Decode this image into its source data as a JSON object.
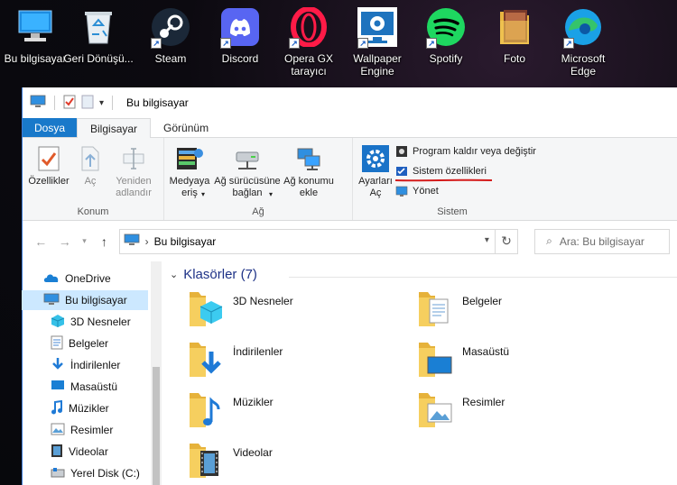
{
  "desktop": {
    "icons": [
      {
        "label": "Bu bilgisayar",
        "icon": "computer-icon"
      },
      {
        "label": "Geri Dönüşü...",
        "icon": "recycle-bin-icon"
      },
      {
        "label": "Steam",
        "icon": "steam-icon"
      },
      {
        "label": "Discord",
        "icon": "discord-icon"
      },
      {
        "label": "Opera GX tarayıcı",
        "icon": "opera-gx-icon"
      },
      {
        "label": "Wallpaper Engine",
        "icon": "wallpaper-engine-icon"
      },
      {
        "label": "Spotify",
        "icon": "spotify-icon"
      },
      {
        "label": "Foto",
        "icon": "photo-icon"
      },
      {
        "label": "Microsoft Edge",
        "icon": "edge-icon"
      }
    ]
  },
  "window": {
    "title": "Bu bilgisayar",
    "tabs": {
      "file": "Dosya",
      "computer": "Bilgisayar",
      "view": "Görünüm"
    },
    "ribbon": {
      "konum": {
        "label": "Konum",
        "properties": "Özellikler",
        "open": "Aç",
        "rename": "Yeniden adlandır"
      },
      "ag": {
        "label": "Ağ",
        "media_access": "Medyaya eriş",
        "map_drive": "Ağ sürücüsüne bağlan",
        "add_location": "Ağ konumu ekle"
      },
      "sistem": {
        "label": "Sistem",
        "settings": "Ayarları Aç",
        "uninstall": "Program kaldır veya değiştir",
        "system_properties": "Sistem özellikleri",
        "manage": "Yönet"
      }
    },
    "address": {
      "path": "Bu bilgisayar",
      "search_placeholder": "Ara: Bu bilgisayar"
    },
    "nav": [
      {
        "label": "OneDrive",
        "icon": "onedrive-icon"
      },
      {
        "label": "Bu bilgisayar",
        "icon": "computer-icon"
      },
      {
        "label": "3D Nesneler",
        "icon": "3d-objects-icon"
      },
      {
        "label": "Belgeler",
        "icon": "documents-icon"
      },
      {
        "label": "İndirilenler",
        "icon": "downloads-icon"
      },
      {
        "label": "Masaüstü",
        "icon": "desktop-icon"
      },
      {
        "label": "Müzikler",
        "icon": "music-icon"
      },
      {
        "label": "Resimler",
        "icon": "pictures-icon"
      },
      {
        "label": "Videolar",
        "icon": "videos-icon"
      },
      {
        "label": "Yerel Disk (C:)",
        "icon": "local-disk-icon"
      }
    ],
    "folders_header": "Klasörler (7)",
    "folders": [
      {
        "label": "3D Nesneler",
        "icon": "3d-objects-icon"
      },
      {
        "label": "Belgeler",
        "icon": "documents-icon"
      },
      {
        "label": "İndirilenler",
        "icon": "downloads-icon"
      },
      {
        "label": "Masaüstü",
        "icon": "desktop-icon"
      },
      {
        "label": "Müzikler",
        "icon": "music-icon"
      },
      {
        "label": "Resimler",
        "icon": "pictures-icon"
      },
      {
        "label": "Videolar",
        "icon": "videos-icon"
      }
    ]
  }
}
